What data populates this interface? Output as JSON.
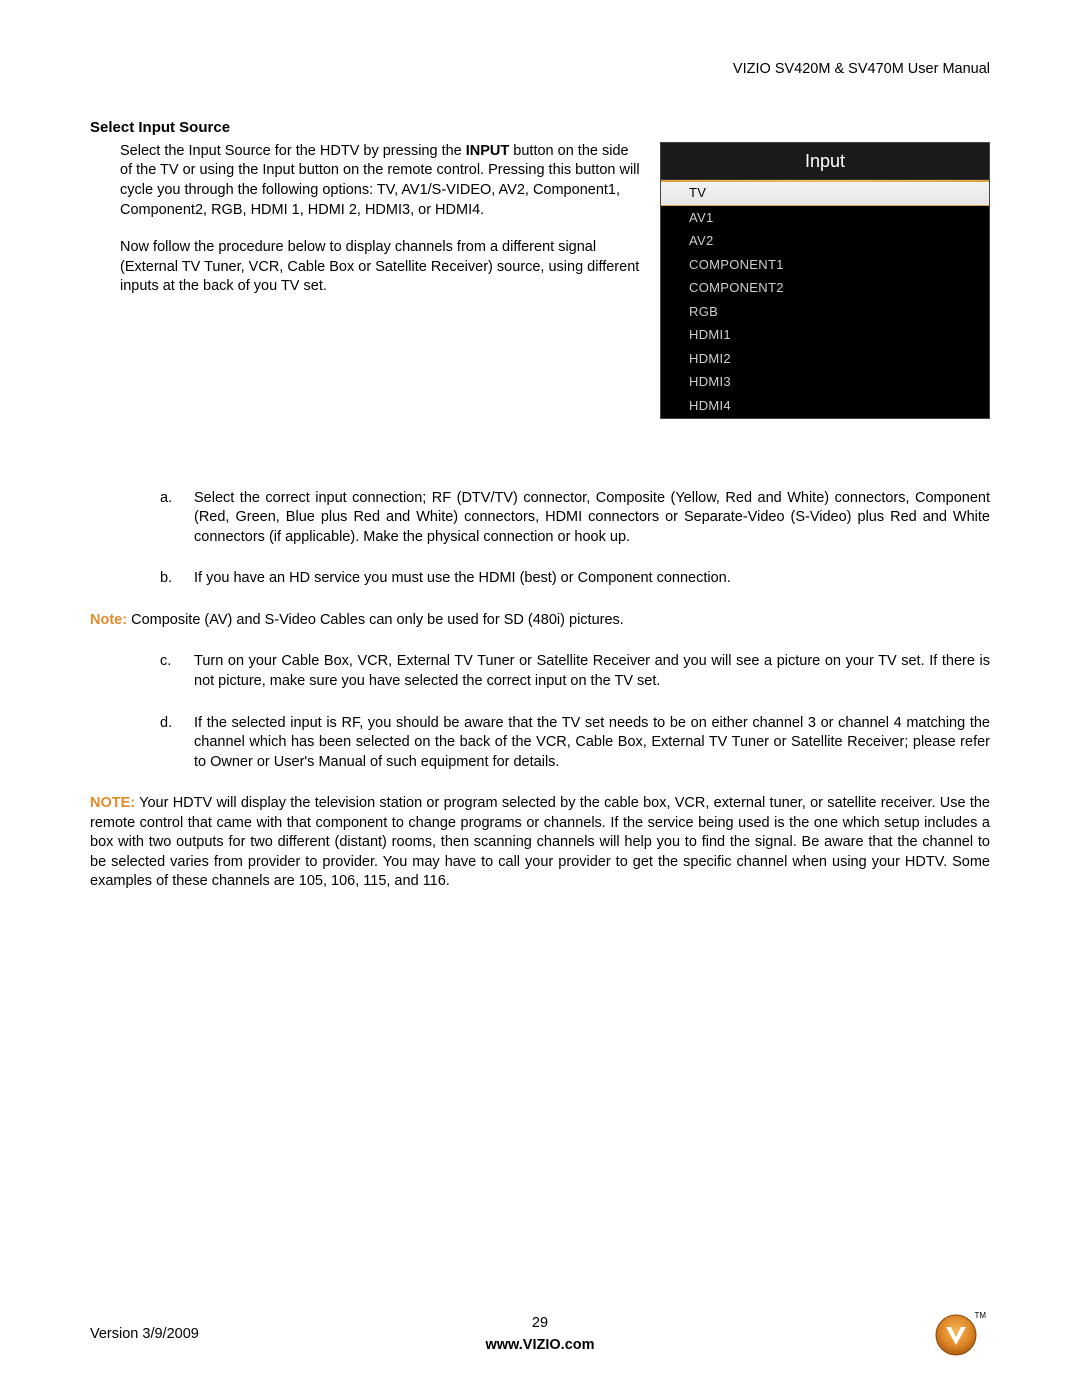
{
  "header": {
    "product": "VIZIO SV420M & SV470M User Manual"
  },
  "section": {
    "title": "Select Input Source",
    "para1_a": "Select the Input Source for the HDTV by pressing the ",
    "para1_bold": "INPUT",
    "para1_b": " button on the side of the TV or using the Input button on the remote control.  Pressing this button will cycle you through the following options: TV, AV1/S-VIDEO, AV2, Component1, Component2, RGB, HDMI 1, HDMI 2, HDMI3, or HDMI4.",
    "para2": "Now follow the procedure below to display channels from a different signal (External TV Tuner, VCR, Cable Box or Satellite Receiver) source, using different inputs at the back of you TV set."
  },
  "input_panel": {
    "title": "Input",
    "items": [
      "TV",
      "AV1",
      "AV2",
      "COMPONENT1",
      "COMPONENT2",
      "RGB",
      "HDMI1",
      "HDMI2",
      "HDMI3",
      "HDMI4"
    ],
    "selected": "TV"
  },
  "steps": {
    "a": {
      "label": "a.",
      "text": "Select the correct input connection; RF (DTV/TV) connector, Composite (Yellow, Red and White) connectors, Component (Red, Green, Blue plus Red and White) connectors, HDMI connectors or Separate-Video (S-Video) plus Red and White connectors (if applicable). Make the physical connection or hook up."
    },
    "b": {
      "label": "b.",
      "text": "If you have an HD service you must use the HDMI (best) or Component connection."
    },
    "c": {
      "label": "c.",
      "text": "Turn on your Cable Box, VCR, External TV Tuner or Satellite Receiver and you will see a picture on your TV set. If there is not picture, make sure you have selected the correct input on the TV set."
    },
    "d": {
      "label": "d.",
      "text": "If the selected input is RF, you should be aware that the TV set needs to be on either channel 3 or channel 4 matching the channel which has been selected on the back of the VCR, Cable Box, External TV Tuner or Satellite Receiver; please refer to Owner or User's Manual of such equipment for details."
    }
  },
  "notes": {
    "note1_label": "Note:",
    "note1_text": "  Composite (AV) and S-Video Cables can only be used for SD (480i) pictures.",
    "note2_label": "NOTE:",
    "note2_text": " Your HDTV will display the television station or program selected by the cable box, VCR, external tuner, or satellite receiver. Use the remote control that came with that component to change programs or channels. If the service being used is the one which setup includes a box with two outputs for two different (distant) rooms, then scanning channels will help you to find the signal. Be aware that the channel to be selected varies from provider to provider. You may have to call your provider to get the specific channel when using your HDTV. Some examples of these channels are 105, 106, 115, and 116."
  },
  "footer": {
    "version": "Version 3/9/2009",
    "page": "29",
    "url": "www.VIZIO.com",
    "tm": "TM"
  },
  "colors": {
    "accent": "#e08a2a"
  }
}
